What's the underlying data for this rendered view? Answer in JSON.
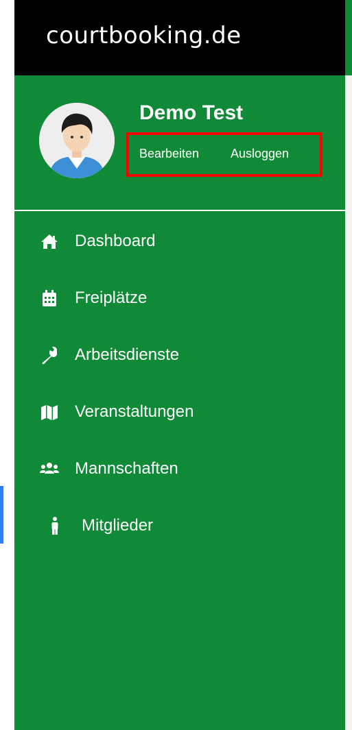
{
  "brand": {
    "name": "courtbooking.de"
  },
  "user": {
    "name": "Demo Test",
    "edit_label": "Bearbeiten",
    "logout_label": "Ausloggen"
  },
  "nav": {
    "items": [
      {
        "label": "Dashboard",
        "icon": "home-icon"
      },
      {
        "label": "Freiplätze",
        "icon": "calendar-icon"
      },
      {
        "label": "Arbeitsdienste",
        "icon": "wrench-icon"
      },
      {
        "label": "Veranstaltungen",
        "icon": "map-icon"
      },
      {
        "label": "Mannschaften",
        "icon": "users-icon"
      },
      {
        "label": "Mitglieder",
        "icon": "person-icon",
        "active": true
      }
    ]
  },
  "colors": {
    "sidebar_bg": "#118a37",
    "brand_bar_bg": "#000000",
    "highlight_border": "#ff0000",
    "active_indicator": "#2e7cf6"
  }
}
